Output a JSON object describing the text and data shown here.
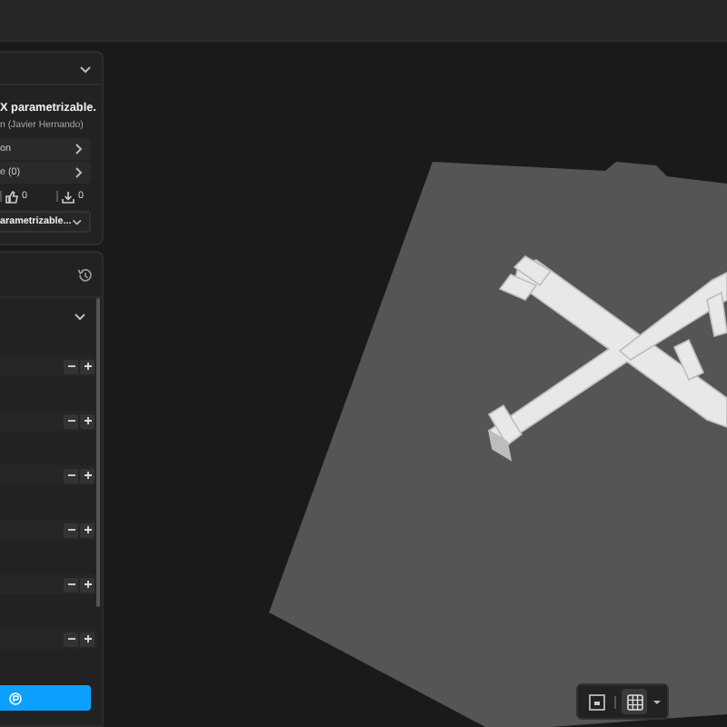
{
  "project": {
    "title": "X parametrizable.",
    "author": "n (Javier Hernando)",
    "links": [
      {
        "label": "on"
      },
      {
        "label": "e (0)"
      }
    ],
    "stats": [
      {
        "kind": "likes",
        "value": "0"
      },
      {
        "kind": "downloads",
        "value": "0"
      }
    ],
    "profile": {
      "value": "arametrizable..."
    }
  },
  "settings": {
    "rows": [
      {
        "kind": "stepper"
      },
      {
        "kind": "stepper"
      },
      {
        "kind": "stepper"
      },
      {
        "kind": "stepper"
      },
      {
        "kind": "stepper"
      },
      {
        "kind": "stepper"
      }
    ]
  },
  "view_toolbar": [
    {
      "kind": "box",
      "selected": false
    },
    {
      "kind": "grid",
      "selected": true
    }
  ]
}
